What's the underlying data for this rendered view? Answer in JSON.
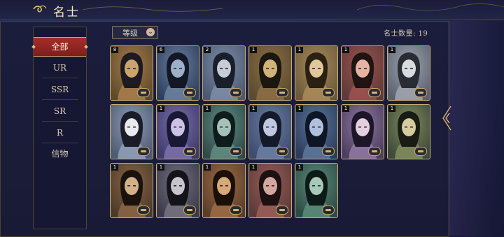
{
  "header": {
    "title": "名士"
  },
  "sidebar": {
    "items": [
      {
        "label": "全部",
        "active": true
      },
      {
        "label": "UR",
        "active": false
      },
      {
        "label": "SSR",
        "active": false
      },
      {
        "label": "SR",
        "active": false
      },
      {
        "label": "R",
        "active": false
      },
      {
        "label": "信物",
        "active": false
      }
    ]
  },
  "filter": {
    "label": "等级",
    "icon": "chevron-down-icon"
  },
  "count": {
    "text": "名士数量: 19"
  },
  "cards": [
    {
      "badge": "8",
      "palette": [
        "#5d4a2a",
        "#c8a56a",
        "#1d1a22",
        "#a77c4c"
      ]
    },
    {
      "badge": "6",
      "palette": [
        "#2d3e5e",
        "#9cb1c9",
        "#141826",
        "#6a7f9c"
      ]
    },
    {
      "badge": "2",
      "palette": [
        "#4a5a72",
        "#c8ccd6",
        "#1a1f2c",
        "#7d8ba4"
      ]
    },
    {
      "badge": "1",
      "palette": [
        "#5a4a30",
        "#d0b27a",
        "#1a1610",
        "#8b6e44"
      ]
    },
    {
      "badge": "1",
      "palette": [
        "#6a5a3a",
        "#e0c898",
        "#2a2014",
        "#a8895a"
      ]
    },
    {
      "badge": "1",
      "palette": [
        "#5e3a38",
        "#e6b3a2",
        "#1e1412",
        "#9a5250"
      ]
    },
    {
      "badge": "1",
      "palette": [
        "#5c6270",
        "#d8dbe0",
        "#2a2c34",
        "#9ea3ae"
      ]
    },
    {
      "badge": "",
      "palette": [
        "#4e5a72",
        "#e8eaf0",
        "#1a1d28",
        "#8f9cb6"
      ]
    },
    {
      "badge": "1",
      "palette": [
        "#3e3a6a",
        "#cbc2e6",
        "#1a1834",
        "#7a6eaa"
      ]
    },
    {
      "badge": "1",
      "palette": [
        "#2f4a4a",
        "#a6c2b8",
        "#0f1c1c",
        "#5f8a80"
      ]
    },
    {
      "badge": "1",
      "palette": [
        "#3c4c6c",
        "#bfc8e0",
        "#141a2a",
        "#6a7ca4"
      ]
    },
    {
      "badge": "1",
      "palette": [
        "#2a3c5c",
        "#aec0dc",
        "#0e1626",
        "#5c7498"
      ]
    },
    {
      "badge": "1",
      "palette": [
        "#4c3e5e",
        "#e4cfe0",
        "#1c1628",
        "#8e76a0"
      ]
    },
    {
      "badge": "1",
      "palette": [
        "#3e4a3a",
        "#d6caa0",
        "#181c14",
        "#7e8a5c"
      ]
    },
    {
      "badge": "1",
      "palette": [
        "#4a3a2a",
        "#d2b08a",
        "#1a120c",
        "#8a6446"
      ]
    },
    {
      "badge": "1",
      "palette": [
        "#3a3a4a",
        "#c8c4cc",
        "#141418",
        "#74707e"
      ]
    },
    {
      "badge": "1",
      "palette": [
        "#5a3e2c",
        "#d8a878",
        "#1a1008",
        "#9a6a44"
      ]
    },
    {
      "badge": "1",
      "palette": [
        "#5c3a3a",
        "#d4a6a0",
        "#1c1010",
        "#985c58"
      ]
    },
    {
      "badge": "1",
      "palette": [
        "#2e4a44",
        "#a8c8b8",
        "#0e1a18",
        "#5a8a78"
      ]
    }
  ]
}
